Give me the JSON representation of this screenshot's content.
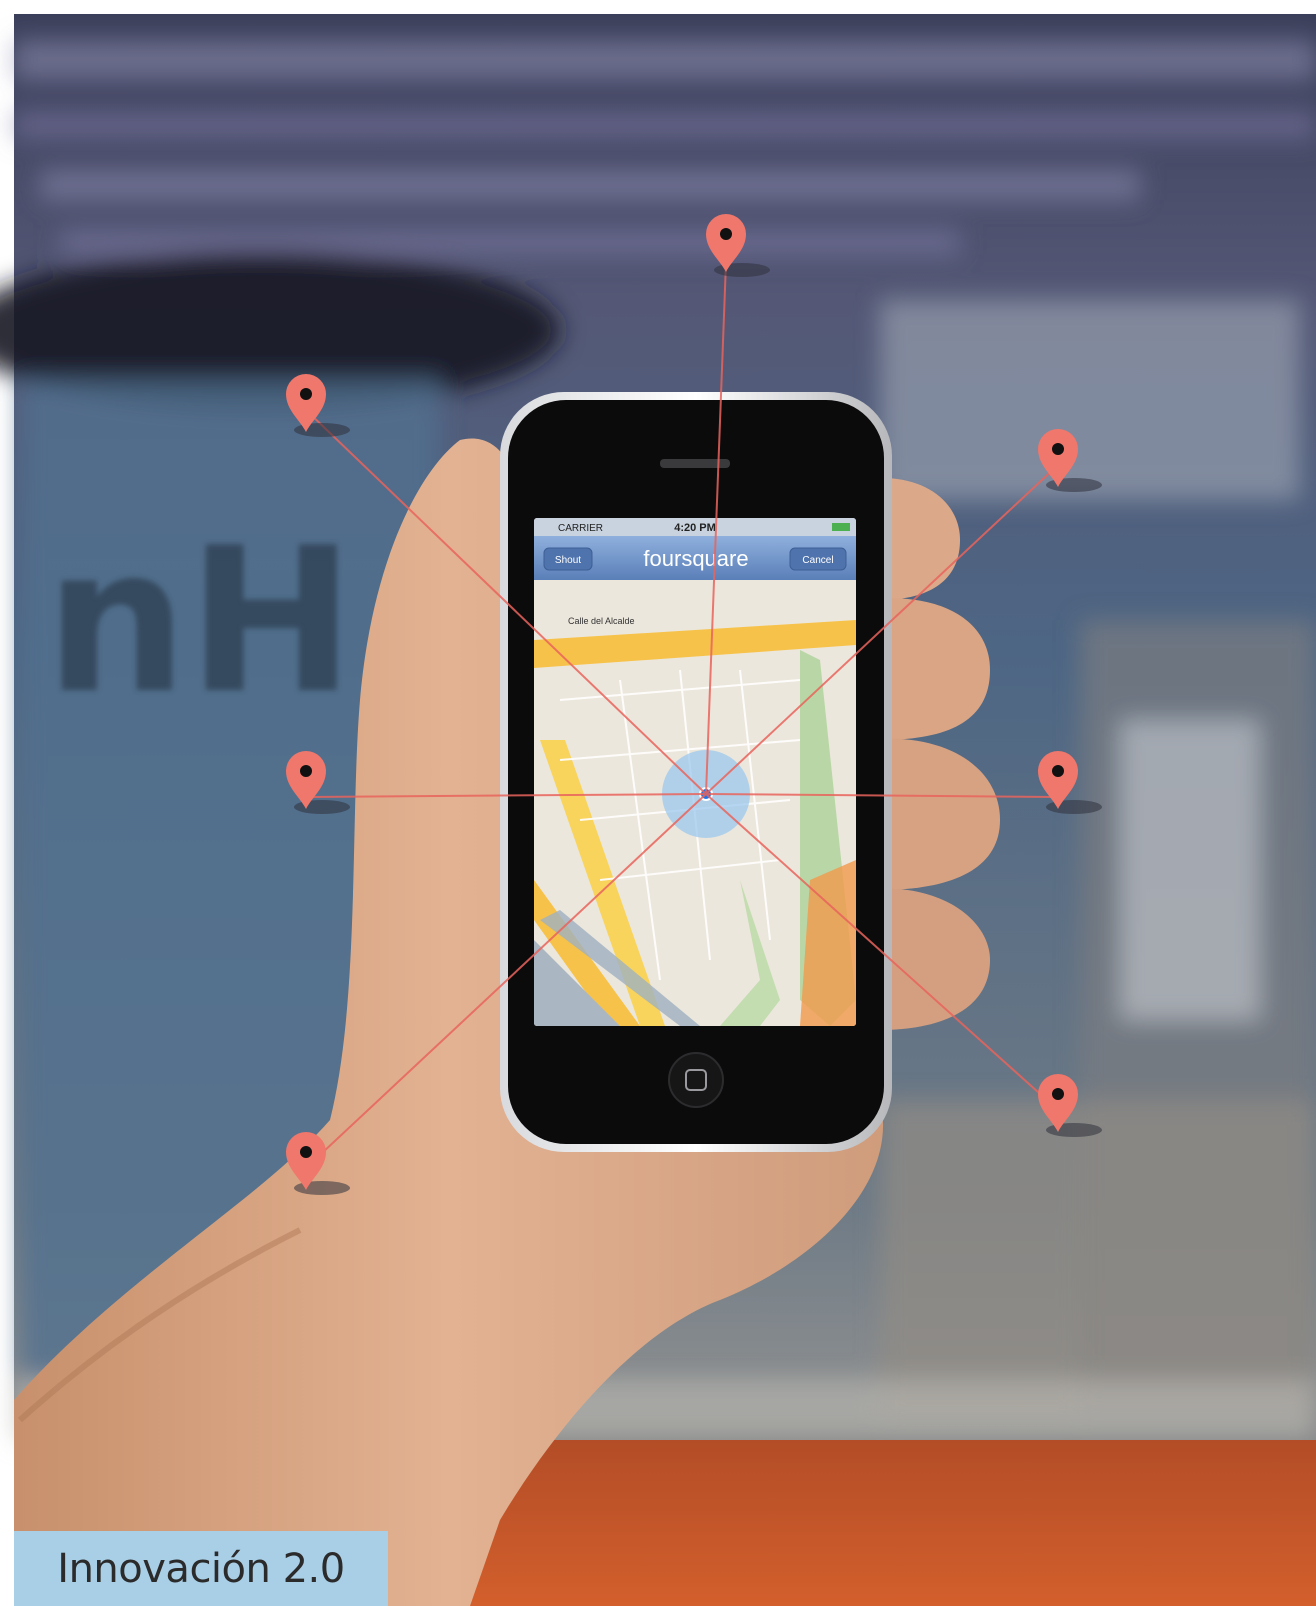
{
  "caption": "Innovación 2.0",
  "hotel_logo": "nH",
  "phone": {
    "status": {
      "carrier": "CARRIER",
      "time": "4:20 PM"
    },
    "nav": {
      "left_button": "Shout",
      "title": "foursquare",
      "right_button": "Cancel"
    },
    "map_labels": {
      "street_top": "Calle del Alcalde"
    },
    "location_indicator": "blue-dot"
  },
  "pins": [
    "map-pin-icon",
    "map-pin-icon",
    "map-pin-icon",
    "map-pin-icon",
    "map-pin-icon",
    "map-pin-icon",
    "map-pin-icon"
  ],
  "colors": {
    "pin": "#f0776b",
    "pin_line": "#e9645c",
    "caption_bg": "#a9cfe6",
    "nav_bar": "#6d8fc4",
    "accuracy_circle": "#9cc8ee",
    "location_dot": "#1a73e8",
    "floor_orange": "#c24a22"
  }
}
